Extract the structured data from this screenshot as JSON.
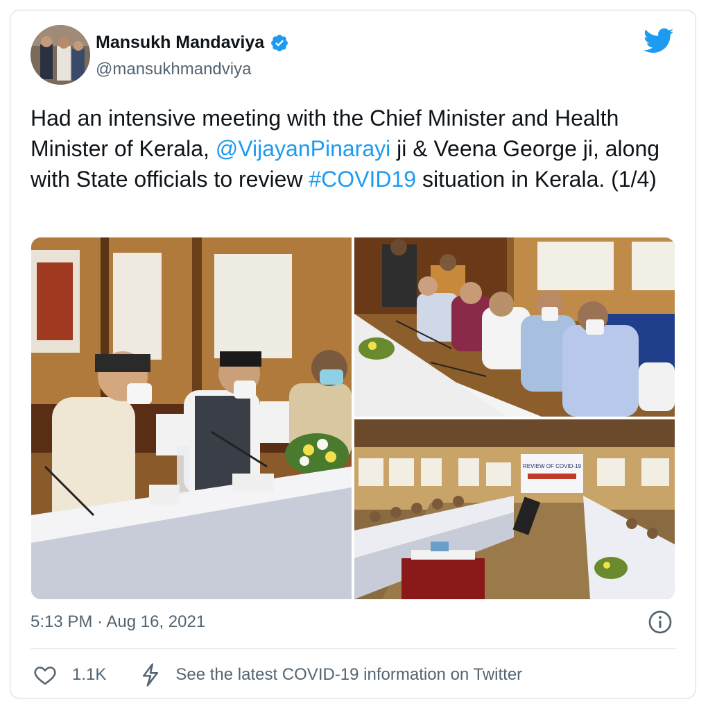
{
  "author": {
    "name": "Mansukh Mandaviya",
    "handle": "@mansukhmandviya",
    "verified_icon": "verified-badge-icon",
    "brand_icon": "twitter-bird-icon",
    "brand_color": "#1d9bf0"
  },
  "tweet": {
    "text_part1": "Had an intensive meeting with the Chief Minister and Health Minister of Kerala, ",
    "mention": "@VijayanPinarayi",
    "text_part2": " ji & Veena George ji, along with State officials to review ",
    "hashtag": "#COVID19",
    "text_part3": " situation in Kerala. (1/4)"
  },
  "media": {
    "count": 3,
    "photo_sign_title": "REVIEW OF COVID-19"
  },
  "meta": {
    "timestamp": "5:13 PM · Aug 16, 2021",
    "info_icon": "info-icon"
  },
  "actions": {
    "like_icon": "heart-icon",
    "like_count": "1.1K",
    "covid_icon": "bolt-icon",
    "covid_info": "See the latest COVID-19 information on Twitter"
  }
}
